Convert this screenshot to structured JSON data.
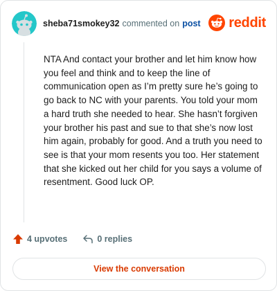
{
  "comment": {
    "author": "sheba71smokey32",
    "action_text": "commented on",
    "target_link": "post",
    "body": "NTA And contact your brother and let him know how you feel and think and to keep the line of communication open as I’m pretty sure he’s going to go back to NC with your parents. You told your mom a hard truth she needed to hear. She hasn’t forgiven your brother his past and sue to that she’s now lost him again, probably for good. And a truth you need to see is that your mom resents you too. Her statement that she kicked out her child for you says a volume of resentment. Good luck OP."
  },
  "brand": {
    "name": "reddit",
    "color": "#ff4500"
  },
  "stats": {
    "upvotes": "4 upvotes",
    "replies": "0 replies"
  },
  "cta": {
    "label": "View the conversation"
  },
  "icons": {
    "avatar": "snoo-avatar-icon",
    "logo": "reddit-logo-icon",
    "upvote": "upvote-arrow-icon",
    "reply": "reply-arrow-icon"
  }
}
